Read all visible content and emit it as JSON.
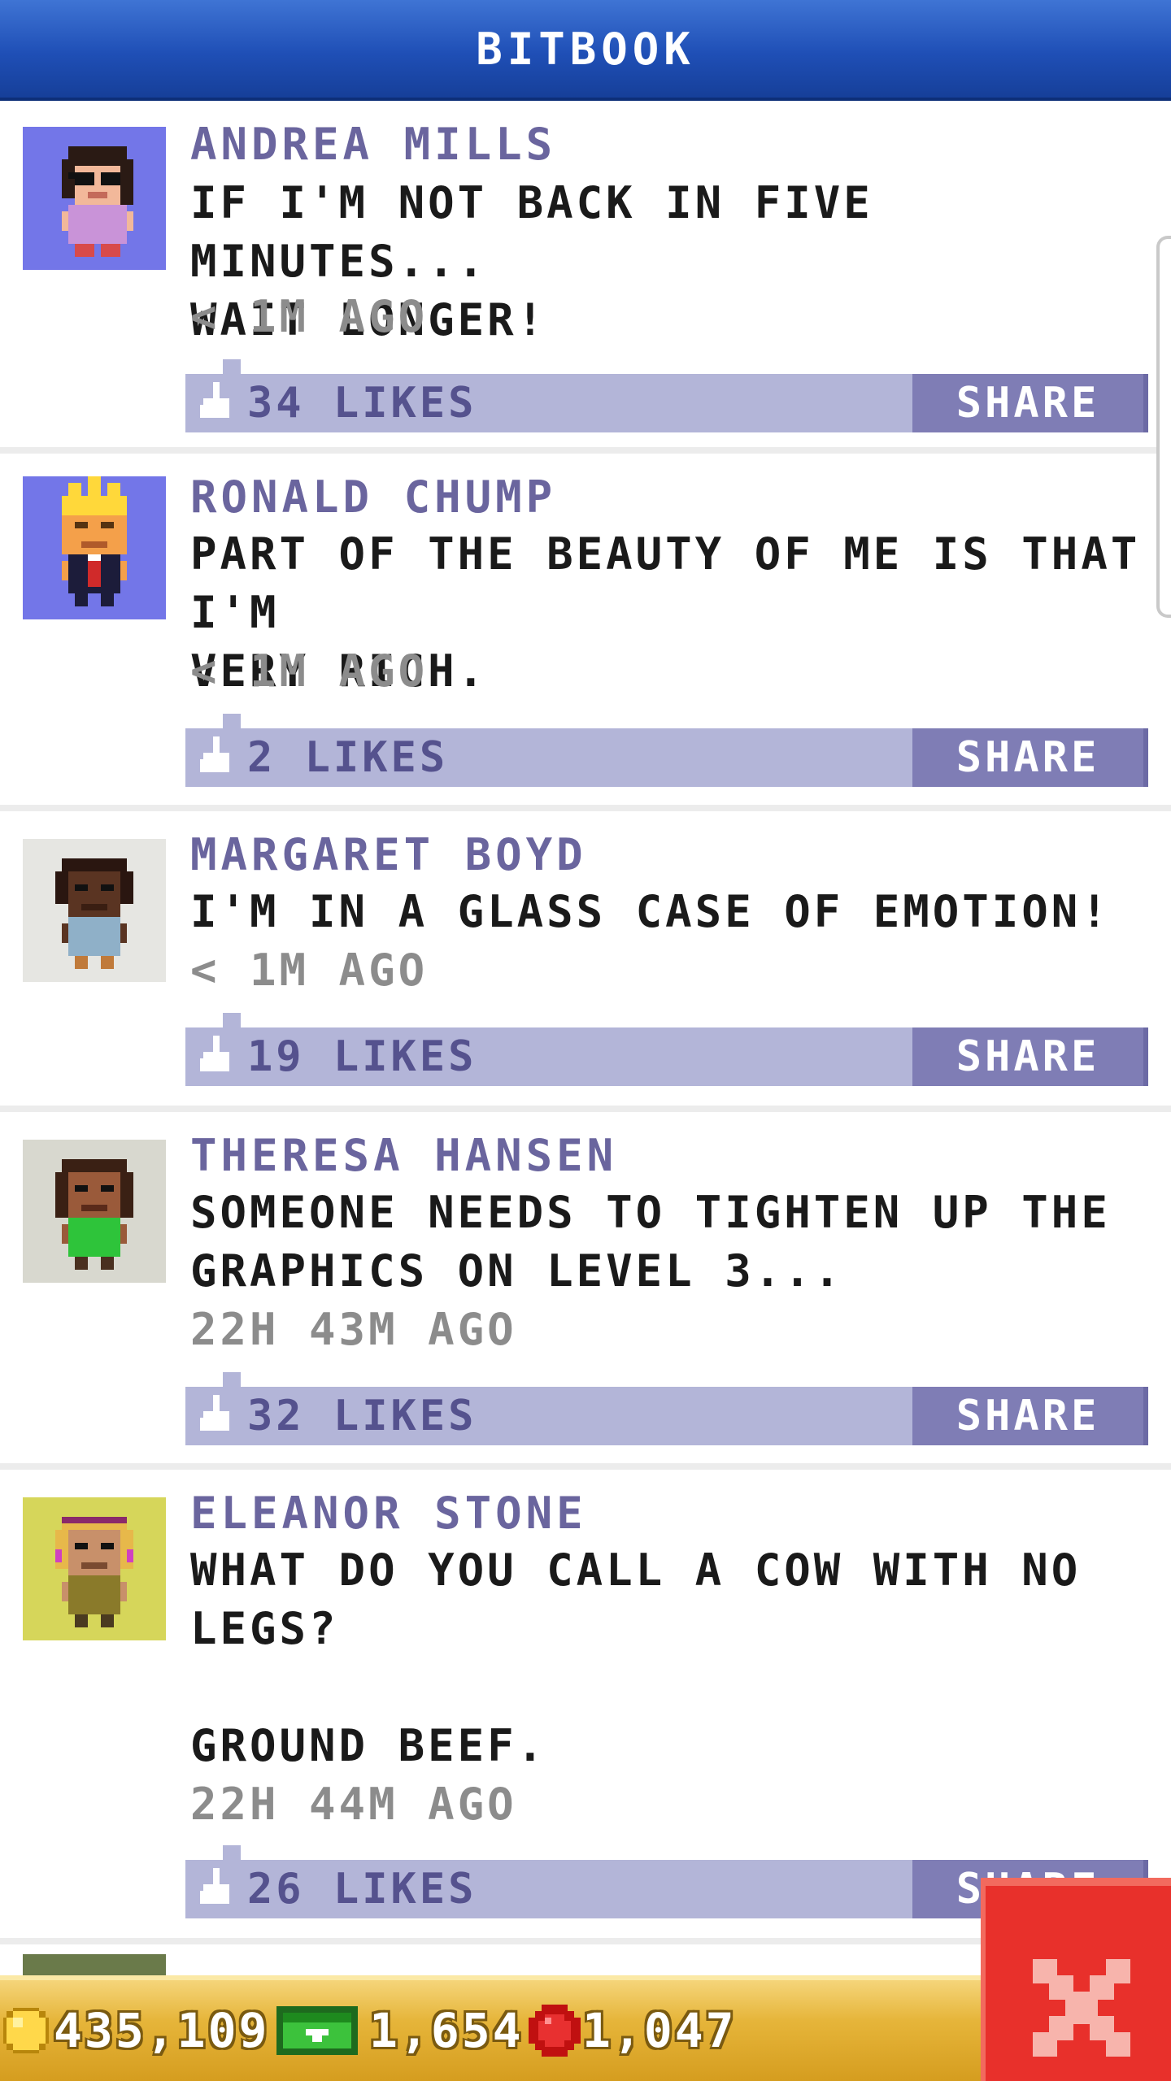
{
  "header": {
    "title": "BITBOOK"
  },
  "posts": [
    {
      "name": "ANDREA MILLS",
      "text": "IF I'M NOT BACK IN FIVE MINUTES...\nWAIT LONGER!",
      "time": "< 1M AGO",
      "likes": "34 LIKES",
      "share": "SHARE",
      "avatar_bg": "#7376e8"
    },
    {
      "name": "RONALD CHUMP",
      "text": "PART OF THE BEAUTY OF ME IS THAT I'M\nVERY RICH.",
      "time": "< 1M AGO",
      "likes": "2 LIKES",
      "share": "SHARE",
      "avatar_bg": "#7376e8"
    },
    {
      "name": "MARGARET BOYD",
      "text": "I'M IN A GLASS CASE OF EMOTION!",
      "time": "< 1M AGO",
      "likes": "19 LIKES",
      "share": "SHARE",
      "avatar_bg": "#e6e6e2"
    },
    {
      "name": "THERESA HANSEN",
      "text": "SOMEONE NEEDS TO TIGHTEN UP THE\nGRAPHICS ON LEVEL 3...",
      "time": "22H 43M AGO",
      "likes": "32 LIKES",
      "share": "SHARE",
      "avatar_bg": "#d8d8cf"
    },
    {
      "name": "ELEANOR STONE",
      "text": "WHAT DO YOU CALL A COW WITH NO\nLEGS?\n\nGROUND BEEF.",
      "time": "22H 44M AGO",
      "likes": "26 LIKES",
      "share": "SHARE",
      "avatar_bg": "#d6d65a"
    }
  ],
  "status": {
    "coins": "435,109",
    "bux": "1,654",
    "gems": "1,047"
  },
  "icons": {
    "like": "like-thumb-icon",
    "coin": "coin-icon",
    "bux": "bux-cash-icon",
    "gem": "red-gem-icon",
    "close": "close-x-icon"
  }
}
